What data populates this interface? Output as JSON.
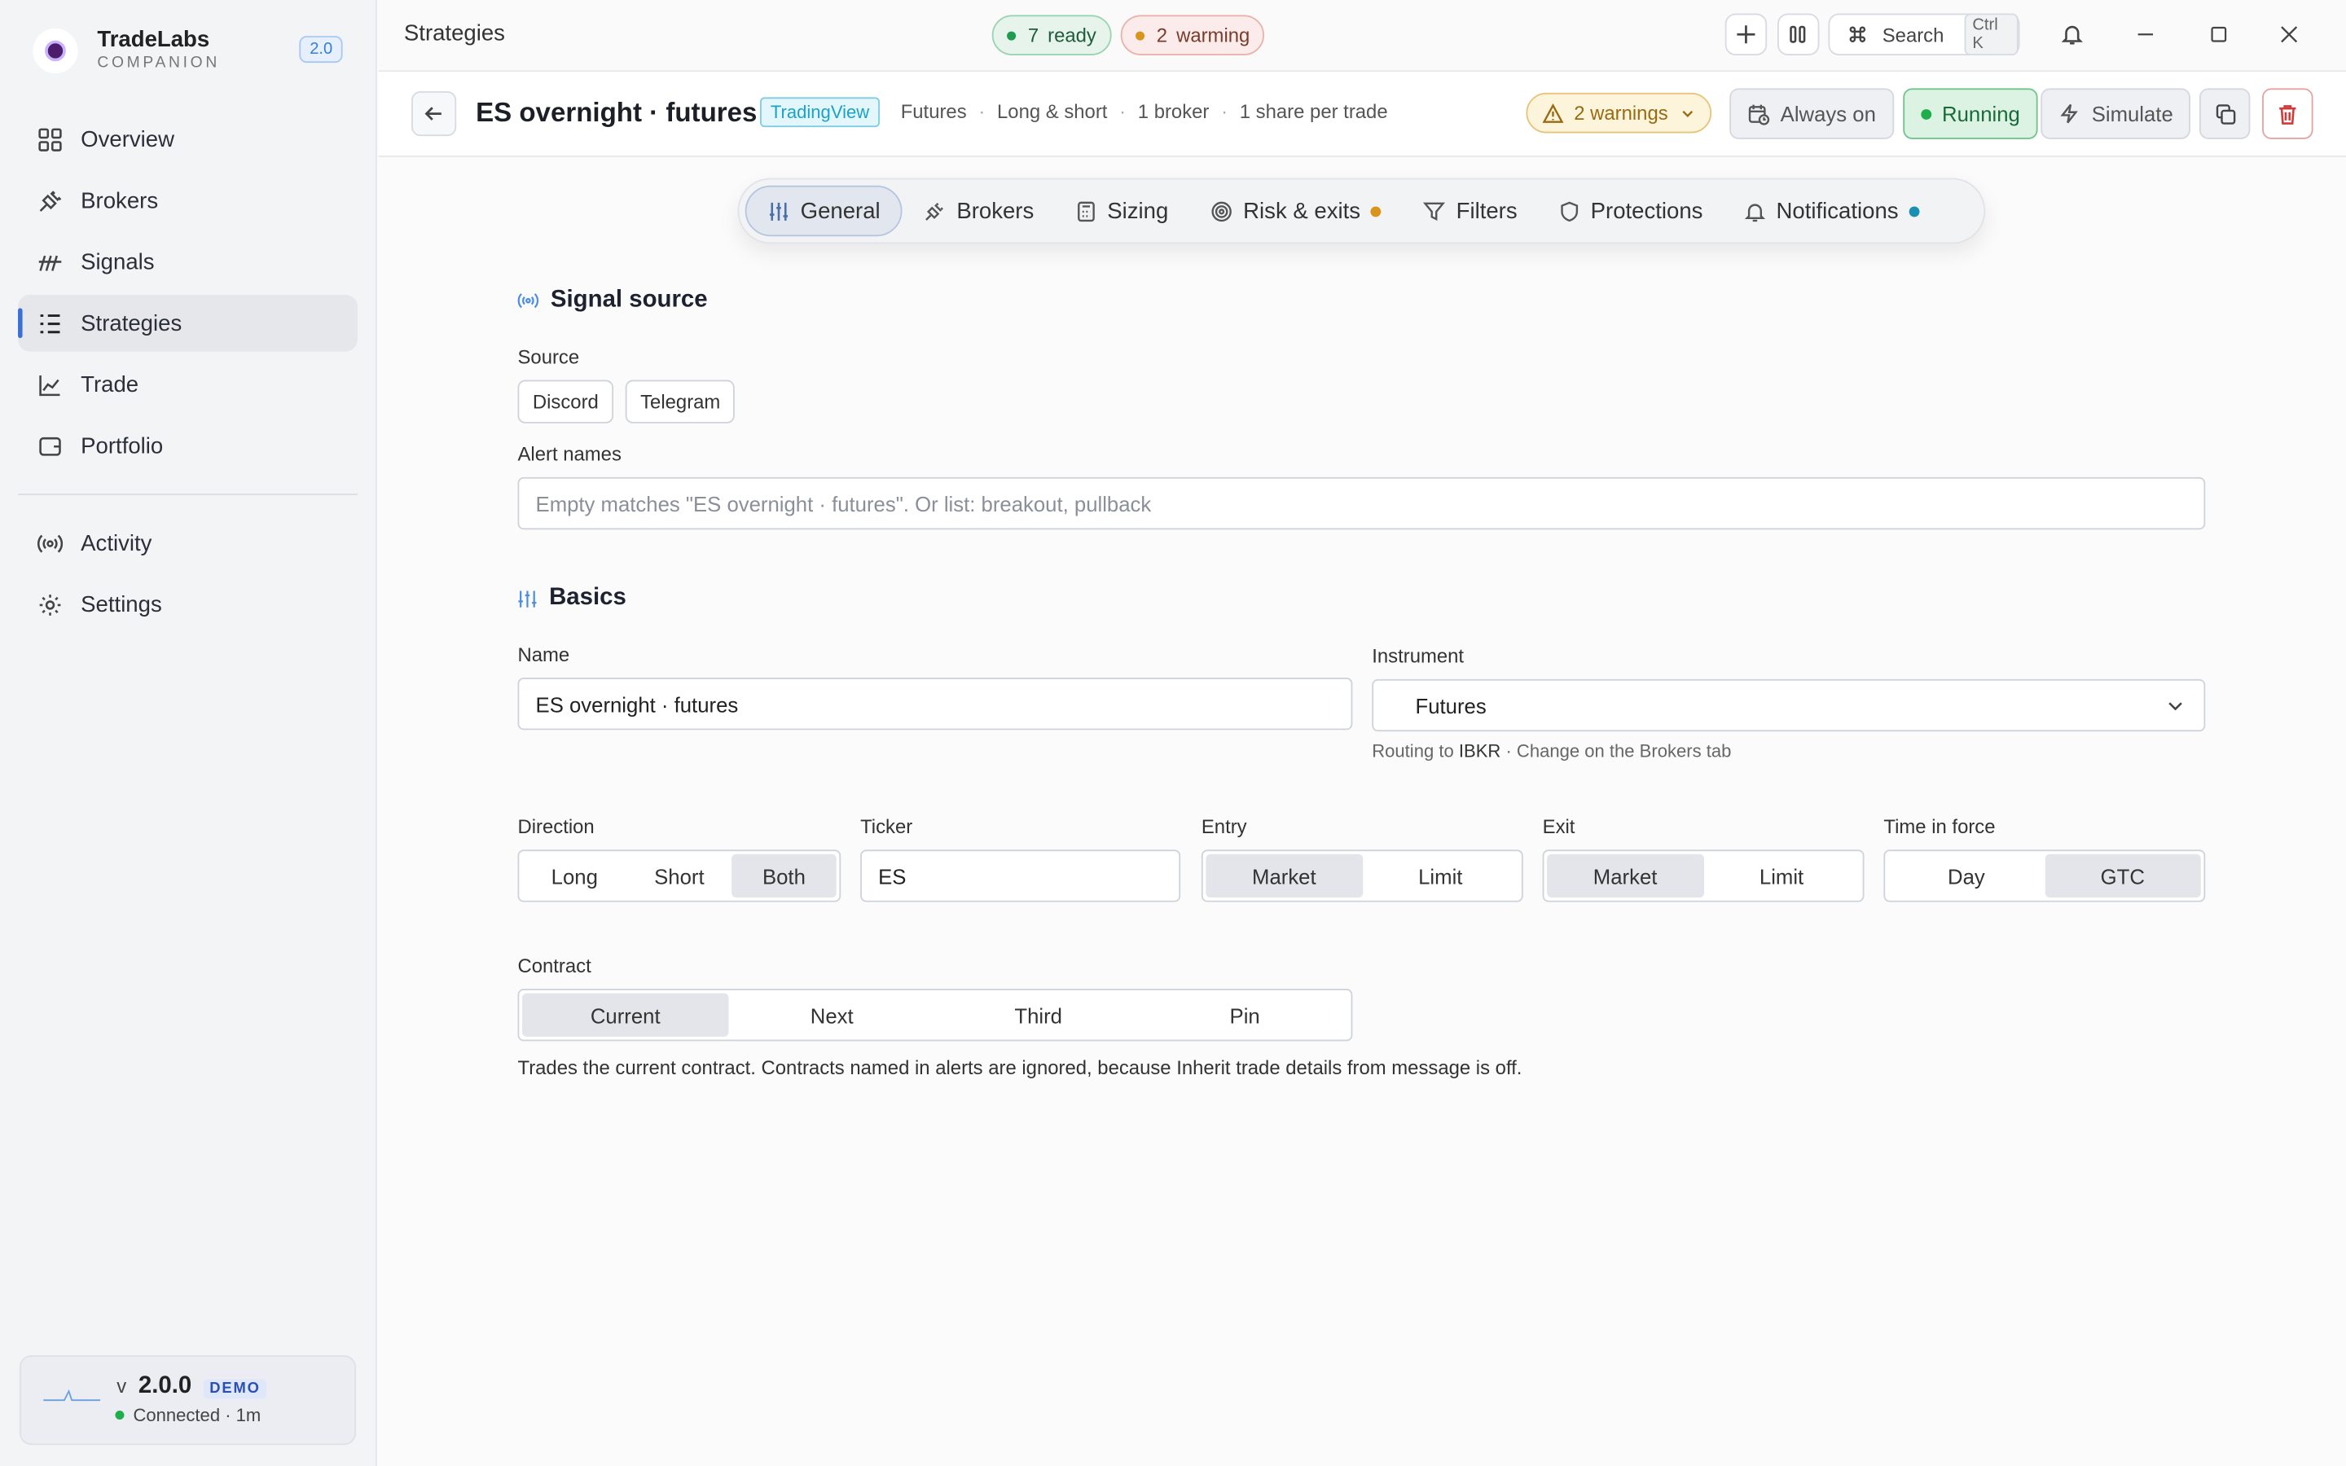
{
  "brand": {
    "name": "TradeLabs",
    "sub": "COMPANION",
    "version_badge": "2.0"
  },
  "sidebar": {
    "items": [
      {
        "label": "Overview",
        "icon": "grid-icon"
      },
      {
        "label": "Brokers",
        "icon": "plug-icon"
      },
      {
        "label": "Signals",
        "icon": "signal-icon"
      },
      {
        "label": "Strategies",
        "icon": "list-icon",
        "active": true
      },
      {
        "label": "Trade",
        "icon": "chart-line-icon"
      },
      {
        "label": "Portfolio",
        "icon": "wallet-icon"
      }
    ],
    "secondary": [
      {
        "label": "Activity",
        "icon": "broadcast-icon"
      },
      {
        "label": "Settings",
        "icon": "gear-icon"
      }
    ],
    "status": {
      "v_prefix": "v",
      "version": "2.0.0",
      "badge": "DEMO",
      "connection": "Connected · 1m"
    }
  },
  "topbar": {
    "title": "Strategies",
    "ready_count": "7",
    "ready_label": "ready",
    "warming_count": "2",
    "warming_label": "warming",
    "search_label": "Search",
    "search_shortcut": "Ctrl K"
  },
  "header": {
    "title": "ES overnight · futures",
    "source_badge": "TradingView",
    "meta": [
      "Futures",
      "Long & short",
      "1 broker",
      "1 share per trade"
    ],
    "warnings": "2 warnings",
    "schedule": "Always on",
    "status": "Running",
    "simulate": "Simulate"
  },
  "tabs": [
    {
      "label": "General",
      "icon": "sliders-icon",
      "active": true
    },
    {
      "label": "Brokers",
      "icon": "plug-icon"
    },
    {
      "label": "Sizing",
      "icon": "calculator-icon"
    },
    {
      "label": "Risk & exits",
      "icon": "target-icon",
      "dot": "#d9951b"
    },
    {
      "label": "Filters",
      "icon": "filter-icon"
    },
    {
      "label": "Protections",
      "icon": "shield-icon"
    },
    {
      "label": "Notifications",
      "icon": "bell-icon",
      "dot": "#1b8fb3"
    }
  ],
  "signal_source": {
    "title": "Signal source",
    "source_label": "Source",
    "sources": [
      "Discord",
      "Telegram"
    ],
    "alert_label": "Alert names",
    "alert_placeholder": "Empty matches \"ES overnight · futures\". Or list: breakout, pullback"
  },
  "basics": {
    "title": "Basics",
    "name_label": "Name",
    "name_value": "ES overnight · futures",
    "instrument_label": "Instrument",
    "instrument_value": "Futures",
    "routing_prefix": "Routing to",
    "routing_broker": "IBKR",
    "routing_suffix": "· Change on the Brokers tab",
    "direction_label": "Direction",
    "direction": [
      "Long",
      "Short",
      "Both"
    ],
    "direction_selected": "Both",
    "ticker_label": "Ticker",
    "ticker_value": "ES",
    "entry_label": "Entry",
    "entry": [
      "Market",
      "Limit"
    ],
    "exit_label": "Exit",
    "exit": [
      "Market",
      "Limit"
    ],
    "tif_label": "Time in force",
    "tif": [
      "Day",
      "GTC"
    ],
    "contract_label": "Contract",
    "contract": [
      "Current",
      "Next",
      "Third",
      "Pin"
    ],
    "contract_desc": "Trades the current contract. Contracts named in alerts are ignored, because Inherit trade details from message is off."
  }
}
